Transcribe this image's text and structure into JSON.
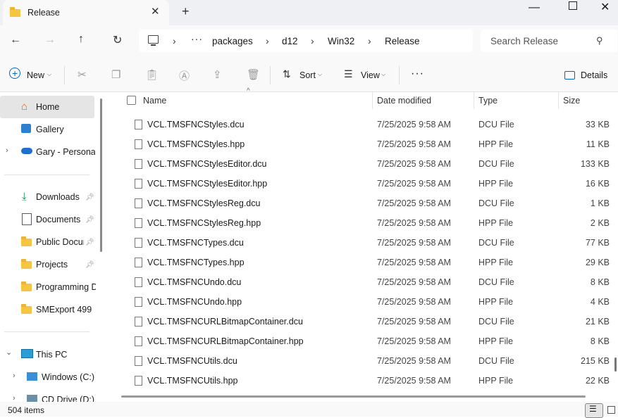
{
  "tab": {
    "title": "Release"
  },
  "breadcrumbs": [
    "packages",
    "d12",
    "Win32",
    "Release"
  ],
  "search": {
    "placeholder": "Search Release"
  },
  "commands": {
    "new": "New",
    "sort": "Sort",
    "view": "View",
    "details": "Details"
  },
  "sidebar": {
    "items": [
      {
        "label": "Home"
      },
      {
        "label": "Gallery"
      },
      {
        "label": "Gary - Personal"
      },
      {
        "label": "Downloads"
      },
      {
        "label": "Documents"
      },
      {
        "label": "Public Docur"
      },
      {
        "label": "Projects"
      },
      {
        "label": "Programming D"
      },
      {
        "label": "SMExport 499"
      },
      {
        "label": "This PC"
      },
      {
        "label": "Windows (C:)"
      },
      {
        "label": "CD Drive (D:) V"
      }
    ]
  },
  "columns": {
    "name": "Name",
    "date": "Date modified",
    "type": "Type",
    "size": "Size"
  },
  "files": [
    {
      "name": "VCL.TMSFNCStyles.dcu",
      "date": "7/25/2025 9:58 AM",
      "type": "DCU File",
      "size": "33 KB"
    },
    {
      "name": "VCL.TMSFNCStyles.hpp",
      "date": "7/25/2025 9:58 AM",
      "type": "HPP File",
      "size": "11 KB"
    },
    {
      "name": "VCL.TMSFNCStylesEditor.dcu",
      "date": "7/25/2025 9:58 AM",
      "type": "DCU File",
      "size": "133 KB"
    },
    {
      "name": "VCL.TMSFNCStylesEditor.hpp",
      "date": "7/25/2025 9:58 AM",
      "type": "HPP File",
      "size": "16 KB"
    },
    {
      "name": "VCL.TMSFNCStylesReg.dcu",
      "date": "7/25/2025 9:58 AM",
      "type": "DCU File",
      "size": "1 KB"
    },
    {
      "name": "VCL.TMSFNCStylesReg.hpp",
      "date": "7/25/2025 9:58 AM",
      "type": "HPP File",
      "size": "2 KB"
    },
    {
      "name": "VCL.TMSFNCTypes.dcu",
      "date": "7/25/2025 9:58 AM",
      "type": "DCU File",
      "size": "77 KB"
    },
    {
      "name": "VCL.TMSFNCTypes.hpp",
      "date": "7/25/2025 9:58 AM",
      "type": "HPP File",
      "size": "29 KB"
    },
    {
      "name": "VCL.TMSFNCUndo.dcu",
      "date": "7/25/2025 9:58 AM",
      "type": "DCU File",
      "size": "8 KB"
    },
    {
      "name": "VCL.TMSFNCUndo.hpp",
      "date": "7/25/2025 9:58 AM",
      "type": "HPP File",
      "size": "4 KB"
    },
    {
      "name": "VCL.TMSFNCURLBitmapContainer.dcu",
      "date": "7/25/2025 9:58 AM",
      "type": "DCU File",
      "size": "21 KB"
    },
    {
      "name": "VCL.TMSFNCURLBitmapContainer.hpp",
      "date": "7/25/2025 9:58 AM",
      "type": "HPP File",
      "size": "8 KB"
    },
    {
      "name": "VCL.TMSFNCUtils.dcu",
      "date": "7/25/2025 9:58 AM",
      "type": "DCU File",
      "size": "215 KB"
    },
    {
      "name": "VCL.TMSFNCUtils.hpp",
      "date": "7/25/2025 9:58 AM",
      "type": "HPP File",
      "size": "22 KB"
    }
  ],
  "status": {
    "count": "504 items"
  },
  "colors": {
    "folder": "#f5c542",
    "accent": "#0067c0",
    "selected": "#e5e5e5"
  }
}
